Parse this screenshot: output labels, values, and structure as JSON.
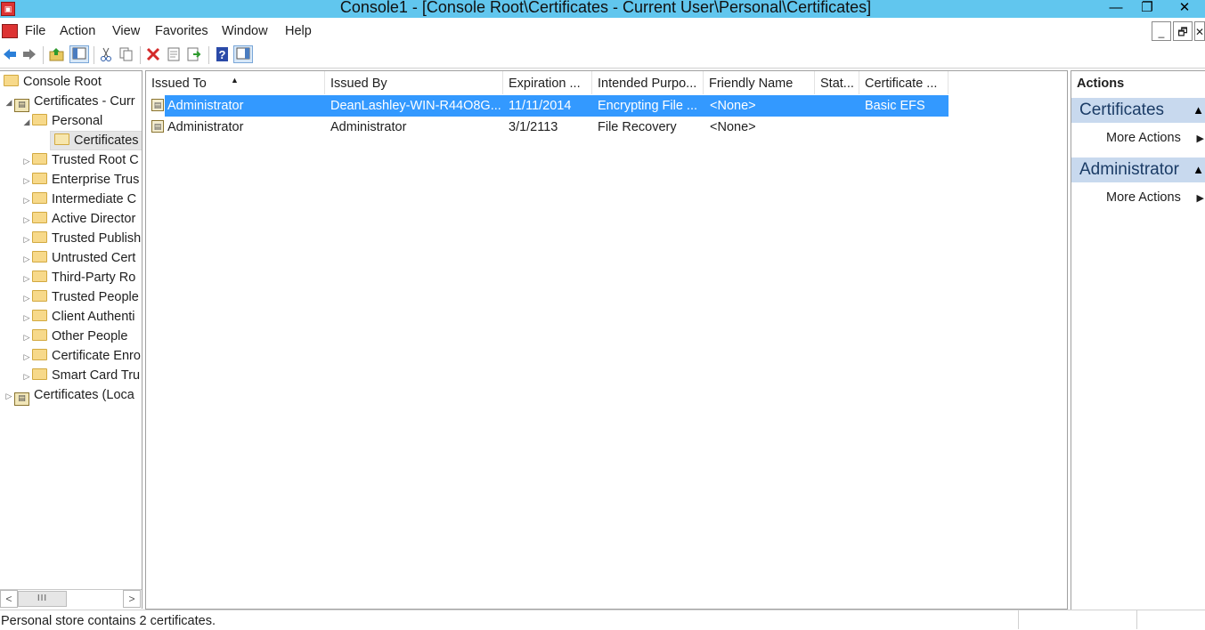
{
  "window": {
    "title": "Console1 - [Console Root\\Certificates - Current User\\Personal\\Certificates]",
    "minimize_glyph": "—",
    "restore_glyph": "❐",
    "close_glyph": "✕"
  },
  "menu": {
    "items": [
      "File",
      "Action",
      "View",
      "Favorites",
      "Window",
      "Help"
    ],
    "mdi_minimize": "_",
    "mdi_restore": "🗗",
    "mdi_close": "✕"
  },
  "toolbar": {
    "icons": [
      "back-icon",
      "forward-icon",
      "up-folder-icon",
      "show-hide-tree-icon",
      "cut-icon",
      "copy-icon",
      "delete-icon",
      "properties-icon",
      "export-icon",
      "help-icon",
      "show-hide-action-pane-icon"
    ]
  },
  "tree": {
    "items": [
      {
        "label": "Console Root",
        "level": 0,
        "expander": "",
        "icon": "folder"
      },
      {
        "label": "Certificates - Curr",
        "level": 1,
        "expander": "◢",
        "icon": "store"
      },
      {
        "label": "Personal",
        "level": 2,
        "expander": "◢",
        "icon": "folder"
      },
      {
        "label": "Certificates",
        "level": 3,
        "expander": "",
        "icon": "folder",
        "selected": true
      },
      {
        "label": "Trusted Root C",
        "level": 2,
        "expander": "▷",
        "icon": "folder"
      },
      {
        "label": "Enterprise Trus",
        "level": 2,
        "expander": "▷",
        "icon": "folder"
      },
      {
        "label": "Intermediate C",
        "level": 2,
        "expander": "▷",
        "icon": "folder"
      },
      {
        "label": "Active Director",
        "level": 2,
        "expander": "▷",
        "icon": "folder"
      },
      {
        "label": "Trusted Publish",
        "level": 2,
        "expander": "▷",
        "icon": "folder"
      },
      {
        "label": "Untrusted Cert",
        "level": 2,
        "expander": "▷",
        "icon": "folder"
      },
      {
        "label": "Third-Party Ro",
        "level": 2,
        "expander": "▷",
        "icon": "folder"
      },
      {
        "label": "Trusted People",
        "level": 2,
        "expander": "▷",
        "icon": "folder"
      },
      {
        "label": "Client Authenti",
        "level": 2,
        "expander": "▷",
        "icon": "folder"
      },
      {
        "label": "Other People",
        "level": 2,
        "expander": "▷",
        "icon": "folder"
      },
      {
        "label": "Certificate Enro",
        "level": 2,
        "expander": "▷",
        "icon": "folder"
      },
      {
        "label": "Smart Card Tru",
        "level": 2,
        "expander": "▷",
        "icon": "folder"
      },
      {
        "label": "Certificates (Loca",
        "level": 1,
        "expander": "▷",
        "icon": "store"
      }
    ],
    "scrollbar": {
      "left_arrow": "<",
      "right_arrow": ">",
      "thumb_grip": "III"
    }
  },
  "list": {
    "columns": [
      "Issued To",
      "Issued By",
      "Expiration ...",
      "Intended Purpo...",
      "Friendly Name",
      "Stat...",
      "Certificate ..."
    ],
    "sort_indicator": "▲",
    "rows": [
      {
        "selected": true,
        "cells": [
          "Administrator",
          "DeanLashley-WIN-R44O8G...",
          "11/11/2014",
          "Encrypting File ...",
          "<None>",
          "",
          "Basic EFS"
        ]
      },
      {
        "selected": false,
        "cells": [
          "Administrator",
          "Administrator",
          "3/1/2113",
          "File Recovery",
          "<None>",
          "",
          ""
        ]
      }
    ]
  },
  "actions": {
    "title": "Actions",
    "sections": [
      {
        "header": "Certificates",
        "collapse_glyph": "▲",
        "items": [
          {
            "label": "More Actions",
            "arrow": "▶"
          }
        ]
      },
      {
        "header": "Administrator",
        "collapse_glyph": "▲",
        "items": [
          {
            "label": "More Actions",
            "arrow": "▶"
          }
        ]
      }
    ]
  },
  "status": {
    "text": "Personal store contains 2 certificates."
  },
  "colors": {
    "title_bar": "#61c6ee",
    "selection": "#3399ff",
    "action_header": "#c8d9ee"
  }
}
